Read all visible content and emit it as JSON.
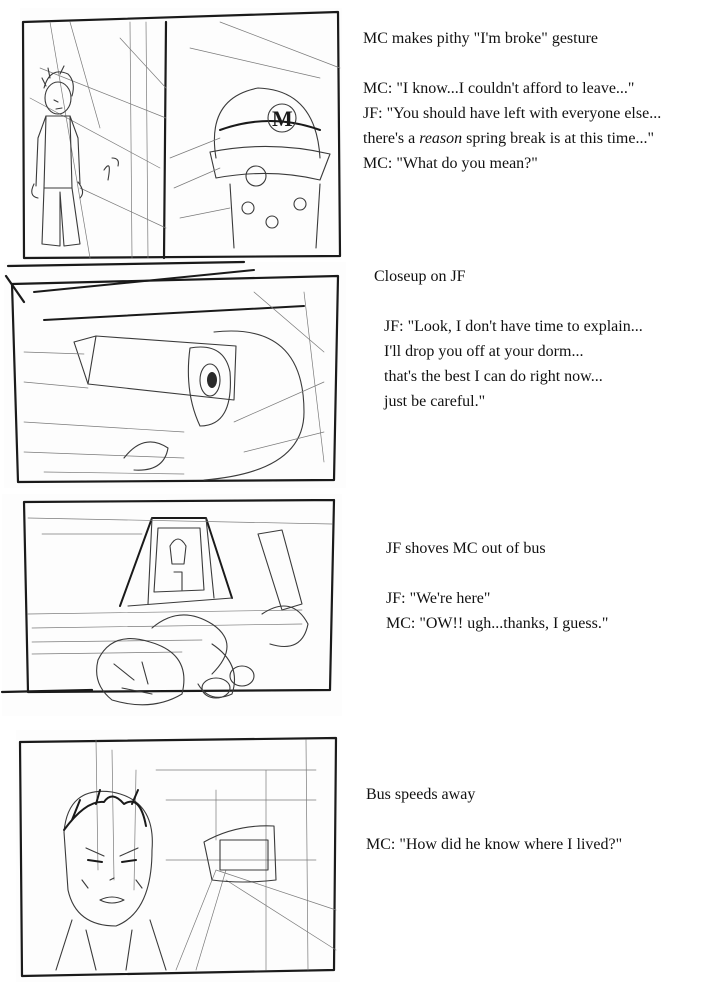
{
  "panels": [
    {
      "lines": [
        {
          "text": "MC makes pithy \"I'm broke\" gesture"
        },
        {
          "gap": true
        },
        {
          "text": "MC: \"I know...I couldn't afford to leave...\""
        },
        {
          "text": "JF: \"You should have left with everyone else..."
        },
        {
          "pre": "there's a ",
          "em": "reason",
          "post": " spring break is at this time...\""
        },
        {
          "text": "MC: \"What do you mean?\""
        }
      ]
    },
    {
      "lines": [
        {
          "text": "Closeup on JF"
        },
        {
          "gap": true
        },
        {
          "text": "JF: \"Look, I don't have time to explain..."
        },
        {
          "text": "I'll drop you off at your dorm..."
        },
        {
          "text": "that's the best I can do right now..."
        },
        {
          "text": "just be careful.\""
        }
      ]
    },
    {
      "lines": [
        {
          "text": "JF shoves MC out of bus"
        },
        {
          "gap": true
        },
        {
          "text": "JF: \"We're here\""
        },
        {
          "text": "MC: \"OW!! ugh...thanks, I guess.\""
        }
      ]
    },
    {
      "lines": [
        {
          "text": "Bus speeds away"
        },
        {
          "gap": true
        },
        {
          "text": "MC: \"How did he know where I lived?\""
        }
      ]
    }
  ],
  "cap_letter": "M"
}
